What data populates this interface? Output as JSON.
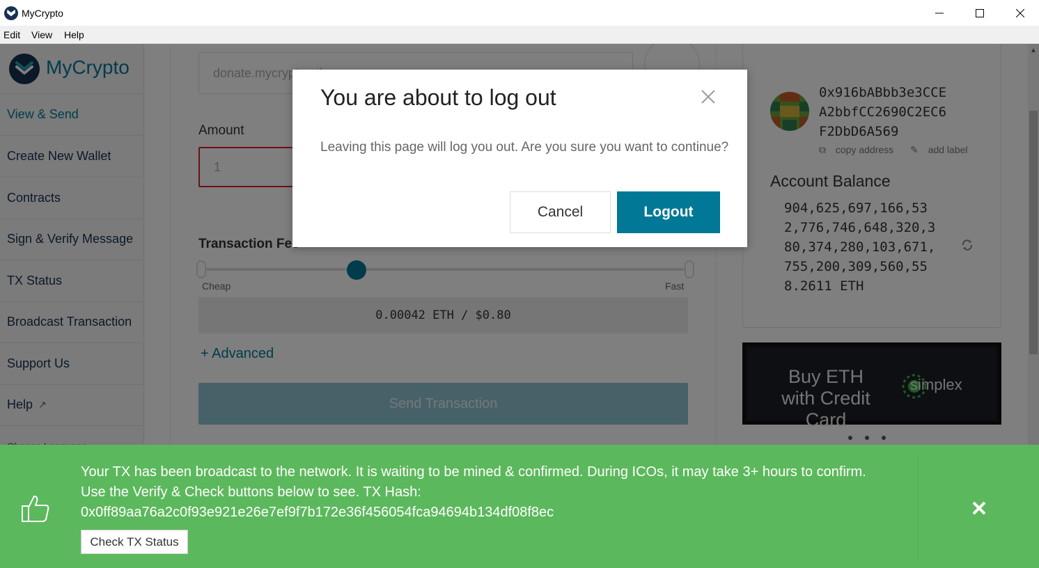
{
  "window": {
    "title": "MyCrypto"
  },
  "menu": {
    "items": [
      "Edit",
      "View",
      "Help"
    ]
  },
  "sidebar": {
    "brand": "MyCrypto",
    "items": [
      {
        "label": "View & Send"
      },
      {
        "label": "Create New Wallet"
      },
      {
        "label": "Contracts"
      },
      {
        "label": "Sign & Verify Message"
      },
      {
        "label": "TX Status"
      },
      {
        "label": "Broadcast Transaction"
      },
      {
        "label": "Support Us"
      },
      {
        "label": "Help"
      }
    ],
    "language_label": "Change Language"
  },
  "send_form": {
    "address_value": "donate.mycrypto.eth",
    "amount_label": "Amount",
    "amount_value": "1",
    "fee_label": "Transaction Fee",
    "slider_cheap": "Cheap",
    "slider_fast": "Fast",
    "fee_display": "0.00042 ETH / $0.80",
    "advanced_link": "+ Advanced",
    "send_button": "Send Transaction"
  },
  "account": {
    "address_lines": [
      "0x916bABbb3e3CCE",
      "A2bbfCC2690C2EC6",
      "F2DbD6A569"
    ],
    "copy_address": "copy address",
    "add_label": "add label",
    "balance_label": "Account Balance",
    "balance_lines": [
      "904,625,697,166,53",
      "2,776,746,648,320,3",
      "80,374,280,103,671,",
      "755,200,309,560,55",
      "8.2611 ETH"
    ]
  },
  "ad": {
    "text": "Buy ETH with Credit Card",
    "brand": "simplex"
  },
  "modal": {
    "title": "You are about to log out",
    "body": "Leaving this page will log you out. Are you sure you want to continue?",
    "cancel": "Cancel",
    "logout": "Logout"
  },
  "notification": {
    "line1": "Your TX has been broadcast to the network. It is waiting to be mined & confirmed. During ICOs, it may take 3+ hours to confirm.",
    "line2": "Use the Verify & Check buttons below to see. TX Hash:",
    "tx_hash": "0x0ff89aa76a2c0f93e921e26e7ef9f7b172e36f456054fca94694b134df08f8ec",
    "check_button": "Check TX Status"
  },
  "colors": {
    "accent": "#007896",
    "navy": "#163151",
    "success": "#5cb85c",
    "error": "#dd2222"
  }
}
